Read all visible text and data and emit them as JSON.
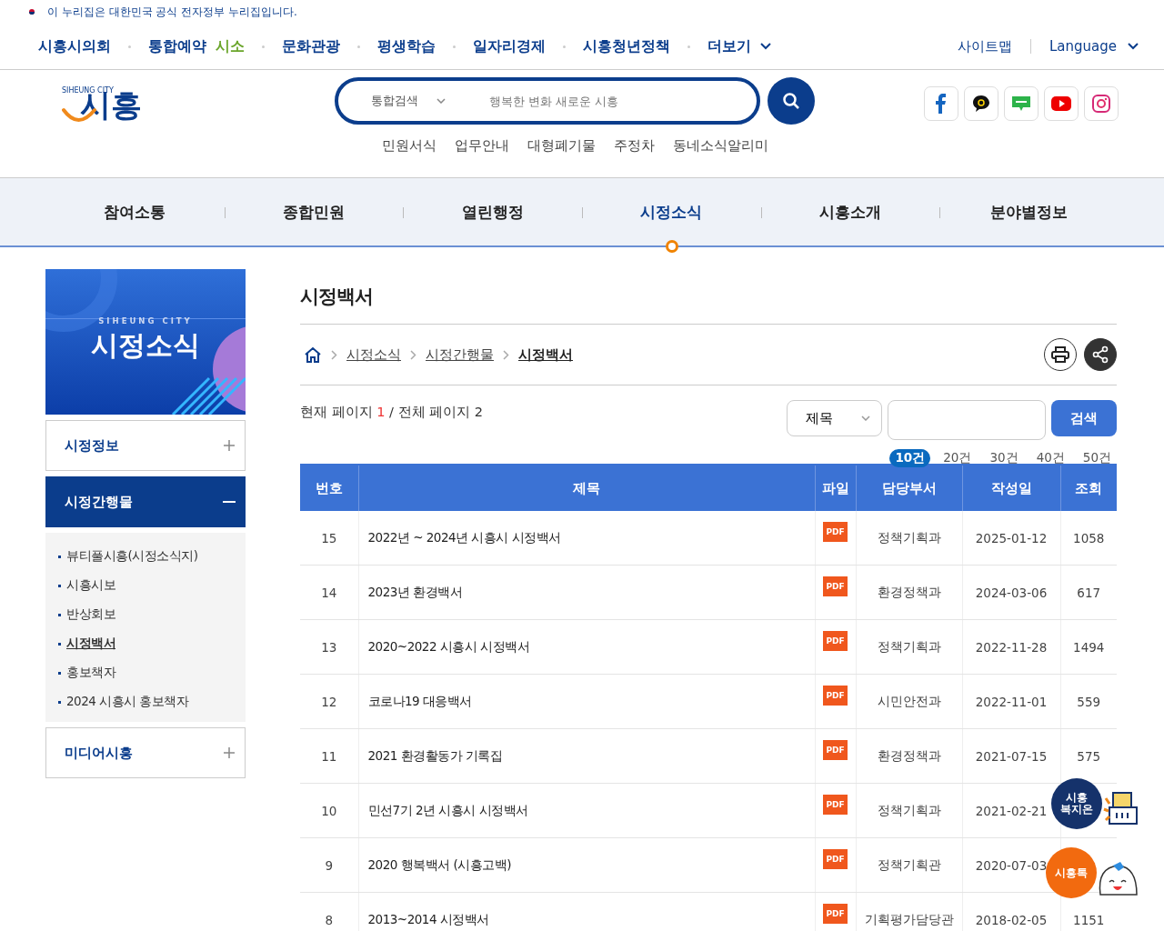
{
  "gov_banner": {
    "text": "이 누리집은 대한민국 공식 전자정부 누리집입니다."
  },
  "top_links": [
    {
      "label": "시흥시의회",
      "dropdown": false
    },
    {
      "label": "통합예약",
      "highlight": "시소",
      "dropdown": false
    },
    {
      "label": "문화관광",
      "dropdown": false
    },
    {
      "label": "평생학습",
      "dropdown": false
    },
    {
      "label": "일자리경제",
      "dropdown": false
    },
    {
      "label": "시흥청년정책",
      "dropdown": false
    },
    {
      "label": "더보기",
      "dropdown": true
    }
  ],
  "utility_links": [
    {
      "label": "사이트맵",
      "dropdown": false
    },
    {
      "label": "Language",
      "dropdown": true
    }
  ],
  "logo": {
    "tagline": "SIHEUNG CITY",
    "name": "시흥"
  },
  "search": {
    "scope": "통합검색",
    "placeholder": "행복한 변화 새로운 시흥"
  },
  "quick_links": [
    "민원서식",
    "업무안내",
    "대형폐기물",
    "주정차",
    "동네소식알리미"
  ],
  "social": [
    {
      "kind": "facebook"
    },
    {
      "kind": "kakao"
    },
    {
      "kind": "blog"
    },
    {
      "kind": "youtube"
    },
    {
      "kind": "instagram"
    }
  ],
  "main_nav": [
    {
      "label": "참여소통",
      "selected": false
    },
    {
      "label": "종합민원",
      "selected": false
    },
    {
      "label": "열린행정",
      "selected": false
    },
    {
      "label": "시정소식",
      "selected": true
    },
    {
      "label": "시흥소개",
      "selected": false
    },
    {
      "label": "분야별정보",
      "selected": false
    }
  ],
  "sidebar": {
    "banner_caption": "SIHEUNG CITY",
    "banner_title": "시정소식",
    "items": [
      {
        "label": "시정정보",
        "expanded": false
      },
      {
        "label": "시정간행물",
        "expanded": true,
        "children": [
          {
            "label": "뷰티풀시흥(시정소식지)",
            "selected": false
          },
          {
            "label": "시흥시보",
            "selected": false
          },
          {
            "label": "반상회보",
            "selected": false
          },
          {
            "label": "시정백서",
            "selected": true
          },
          {
            "label": "홍보책자",
            "selected": false
          },
          {
            "label": "2024 시흥시 홍보책자",
            "selected": false
          }
        ]
      },
      {
        "label": "미디어시흥",
        "expanded": false
      }
    ]
  },
  "page_title": "시정백서",
  "breadcrumb": [
    {
      "label": "시정소식",
      "selected": false
    },
    {
      "label": "시정간행물",
      "selected": false
    },
    {
      "label": "시정백서",
      "selected": true
    }
  ],
  "paging_info": {
    "current_label": "현재 페이지",
    "current": "1",
    "total_label": "/ 전체 페이지 2"
  },
  "filter": {
    "field": "제목",
    "button": "검색"
  },
  "page_sizes": [
    {
      "label": "10건",
      "selected": true
    },
    {
      "label": "20건",
      "selected": false
    },
    {
      "label": "30건",
      "selected": false
    },
    {
      "label": "40건",
      "selected": false
    },
    {
      "label": "50건",
      "selected": false
    }
  ],
  "table": {
    "columns": [
      "번호",
      "제목",
      "파일",
      "담당부서",
      "작성일",
      "조회"
    ],
    "rows": [
      {
        "no": "15",
        "title": "2022년 ~ 2024년 시흥시 시정백서",
        "file": "PDF",
        "dept": "정책기획과",
        "date": "2025-01-12",
        "views": "1058"
      },
      {
        "no": "14",
        "title": "2023년 환경백서",
        "file": "PDF",
        "dept": "환경정책과",
        "date": "2024-03-06",
        "views": "617"
      },
      {
        "no": "13",
        "title": "2020~2022 시흥시 시정백서",
        "file": "PDF",
        "dept": "정책기획과",
        "date": "2022-11-28",
        "views": "1494"
      },
      {
        "no": "12",
        "title": "코로나19 대응백서",
        "file": "PDF",
        "dept": "시민안전과",
        "date": "2022-11-01",
        "views": "559"
      },
      {
        "no": "11",
        "title": "2021 환경활동가 기록집",
        "file": "PDF",
        "dept": "환경정책과",
        "date": "2021-07-15",
        "views": "575"
      },
      {
        "no": "10",
        "title": "민선7기 2년 시흥시 시정백서",
        "file": "PDF",
        "dept": "정책기획과",
        "date": "2021-02-21"
      },
      {
        "no": "9",
        "title": "2020 행복백서 (시흥고백)",
        "file": "PDF",
        "dept": "정책기획관",
        "date": "2020-07-03"
      },
      {
        "no": "8",
        "title": "2013~2014 시정백서",
        "file": "PDF",
        "dept": "기획평가담당관",
        "date": "2018-02-05",
        "views": "1151"
      }
    ]
  },
  "floating": [
    {
      "kind": "welfare",
      "label": "시흥\n복지온"
    },
    {
      "kind": "talk",
      "label": "시흥톡"
    }
  ]
}
